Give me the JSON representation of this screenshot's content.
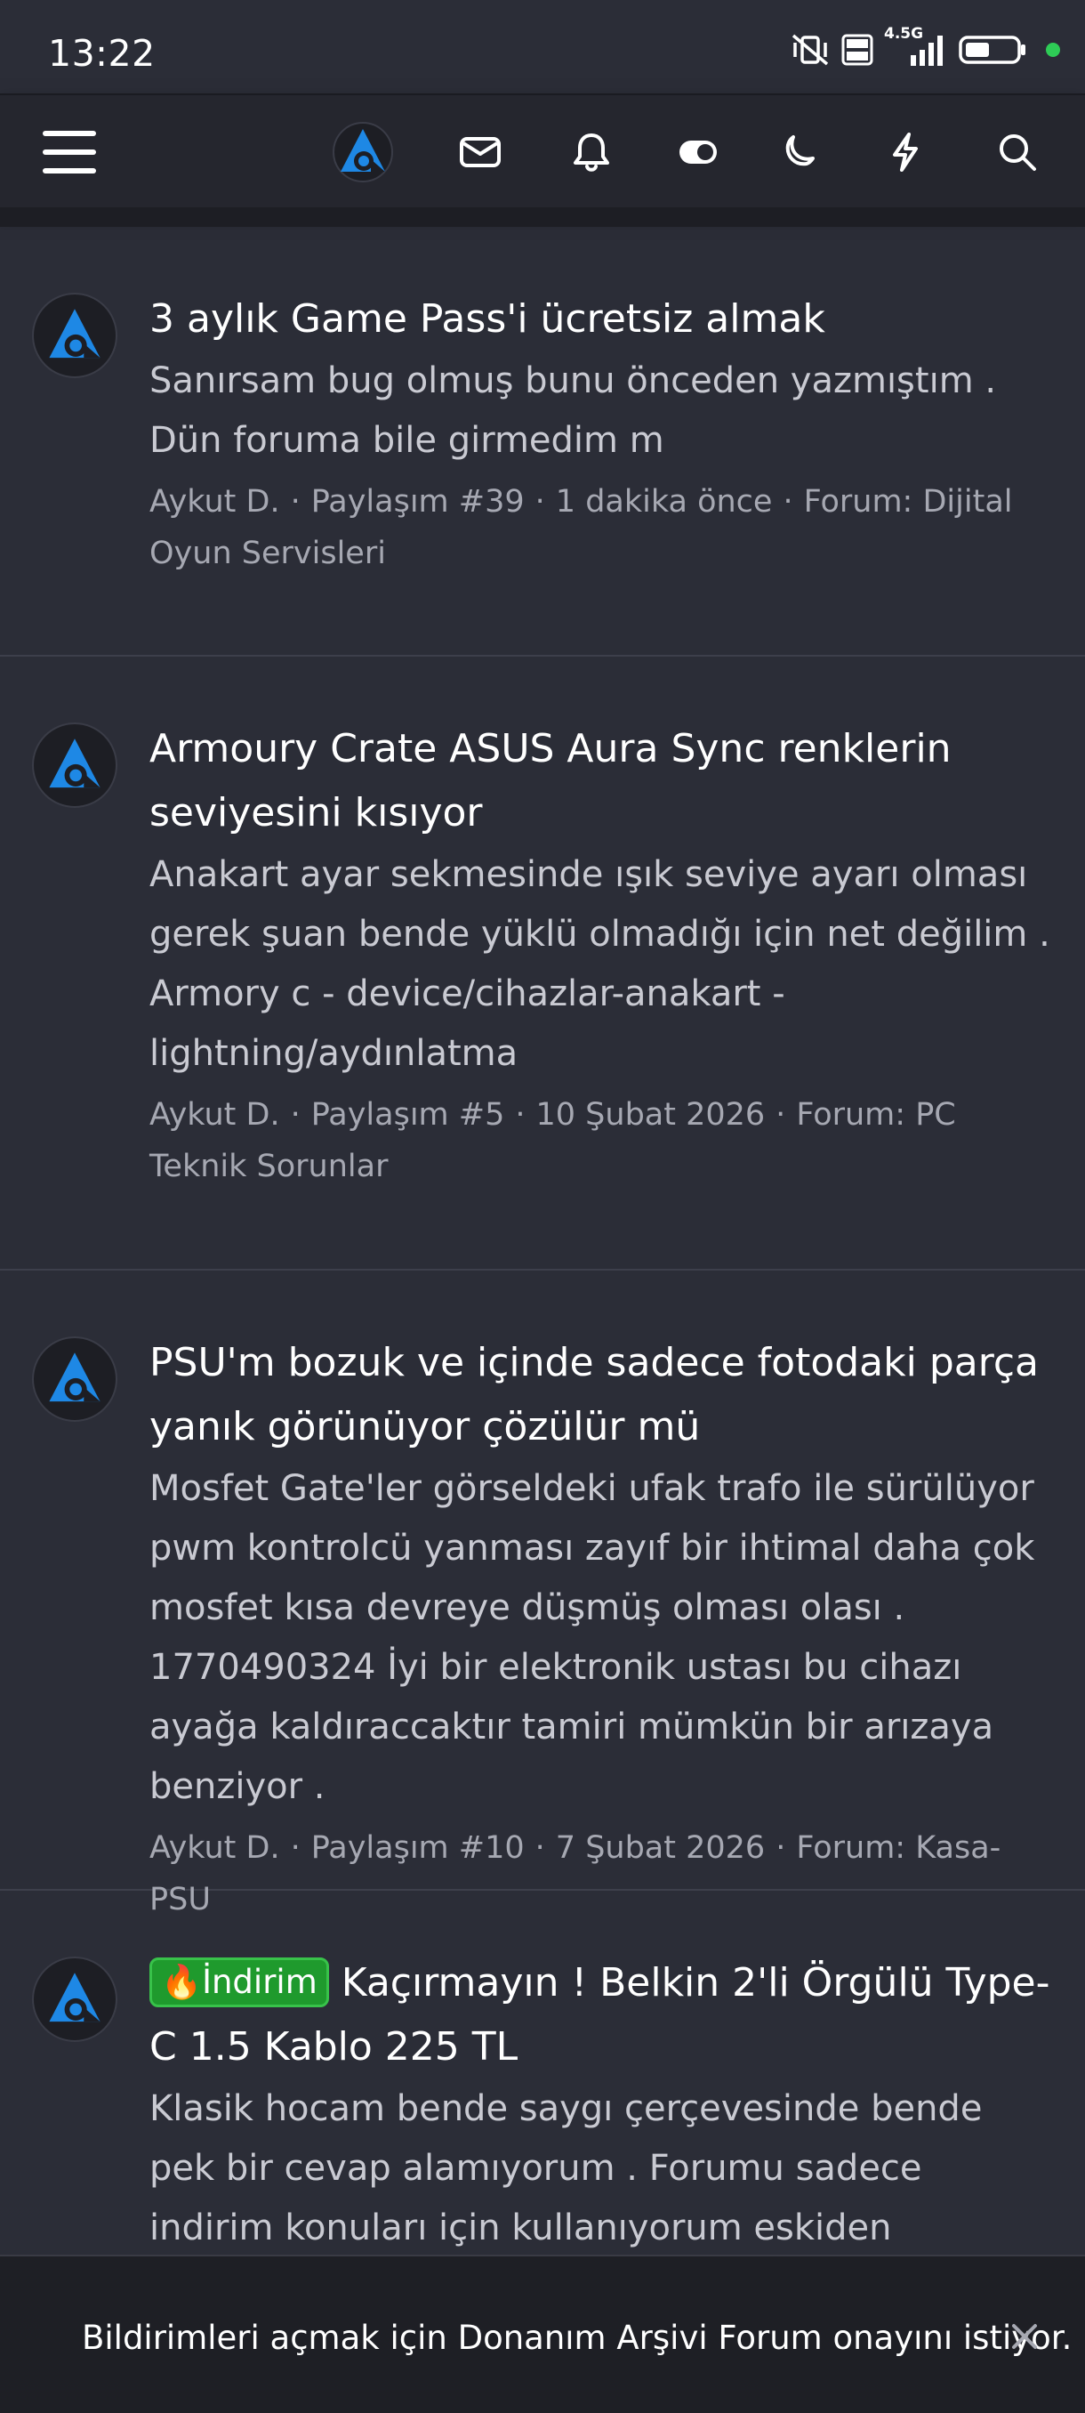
{
  "status_bar": {
    "time": "13:22",
    "network_label_top": "4.5G",
    "volte_label": "Vo LTE",
    "icons": [
      "mute-vibrate-icon",
      "volte-icon",
      "signal-icon",
      "battery-icon",
      "notification-dot"
    ]
  },
  "nav": {
    "icons": [
      "menu-icon",
      "site-logo",
      "inbox-icon",
      "bell-icon",
      "toggle-icon",
      "moon-icon",
      "lightning-icon",
      "search-icon"
    ]
  },
  "posts": [
    {
      "title": "3 aylık Game Pass'i ücretsiz almak",
      "snippet": "Sanırsam bug olmuş bunu önceden yazmıştım . Dün foruma bile girmedim m",
      "author": "Aykut D.",
      "post_no": "Paylaşım #39",
      "time": "1 dakika önce",
      "forum": "Forum: Dijital Oyun Servisleri"
    },
    {
      "title": "Armoury Crate ASUS Aura Sync renklerin seviyesini kısıyor",
      "snippet": "Anakart ayar sekmesinde ışık seviye ayarı olması gerek şuan bende yüklü olmadığı için net değilim . Armory c - device/cihazlar-anakart - lightning/aydınlatma",
      "author": "Aykut D.",
      "post_no": "Paylaşım #5",
      "time": "10 Şubat 2026",
      "forum": "Forum: PC Teknik Sorunlar"
    },
    {
      "title": "PSU'm bozuk ve içinde sadece fotodaki parça yanık görünüyor çözülür mü",
      "snippet": "Mosfet Gate'ler görseldeki ufak trafo ile sürülüyor pwm kontrolcü yanması zayıf bir ihtimal daha çok mosfet kısa devreye düşmüş olması olası . 1770490324 İyi bir elektronik ustası bu cihazı ayağa kaldıraccaktır tamiri mümkün bir arızaya benziyor .",
      "author": "Aykut D.",
      "post_no": "Paylaşım #10",
      "time": "7 Şubat 2026",
      "forum": "Forum: Kasa-PSU"
    },
    {
      "badge": "🔥İndirim",
      "title": "Kaçırmayın ! Belkin 2'li Örgülü Type-C 1.5 Kablo 225 TL",
      "snippet": "Klasik hocam bende saygı çerçevesinde bende pek bir cevap alamıyorum . Forumu sadece indirim konuları için kullanıyorum eskiden insanlara yardım"
    }
  ],
  "notification": {
    "prefix": "Bildirimleri açmak için",
    "site": "Donanım Arşivi Forum",
    "suffix": "onayını istiyor."
  },
  "colors": {
    "background": "#2b2d37",
    "navbar": "#25262e",
    "logo_blue": "#1e88e5",
    "badge_green": "#1f9a2d",
    "status_dot": "#2ecc56"
  }
}
